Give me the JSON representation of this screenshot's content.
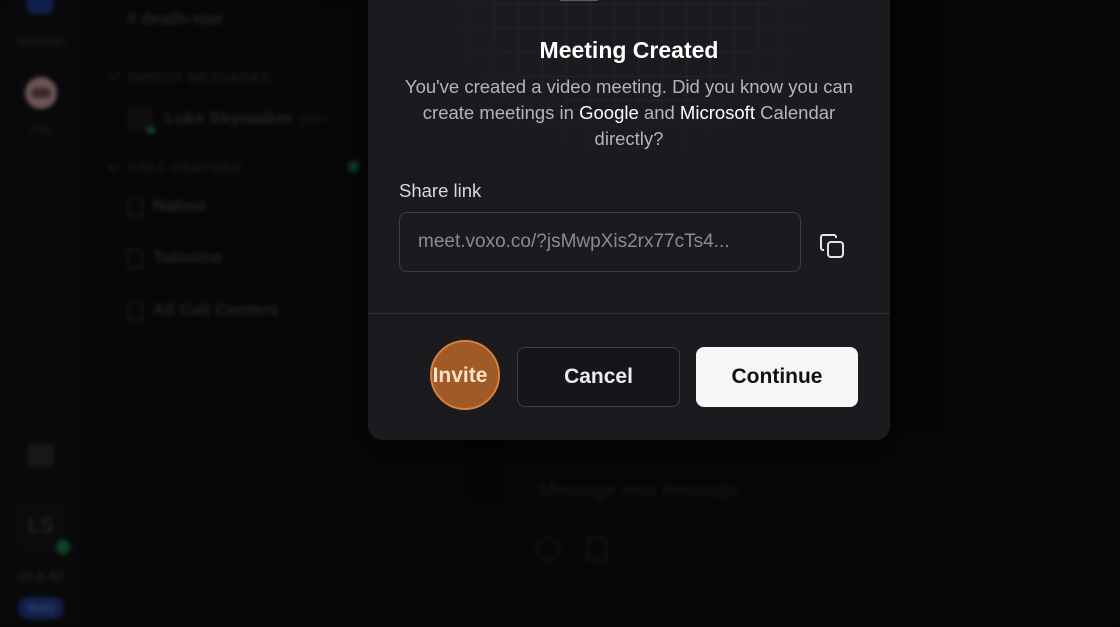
{
  "sidebar_rail": {
    "message_label": "Message",
    "fax_label": "Fax",
    "user_initials": "LS",
    "version": "v0.6.42",
    "beta_badge": "Beta"
  },
  "channel_list": {
    "top_channel": "# death-star",
    "direct_messages_header": "DIRECT MESSAGES",
    "dm_user": "Luke Skywalker",
    "dm_you_tag": "you",
    "call_centers_header": "CALL CENTERS",
    "call_centers": [
      "Naboo",
      "Tatooine",
      "All Call Centers"
    ]
  },
  "composer": {
    "placeholder": "Message new message..."
  },
  "modal": {
    "title": "Meeting Created",
    "description_part1": "You've created a video meeting. Did you know you can create meetings in ",
    "google": "Google",
    "and": " and ",
    "microsoft": "Microsoft",
    "description_part2": " Calendar directly?",
    "share_label": "Share link",
    "share_link": "meet.voxo.co/?jsMwpXis2rx77cTs4...",
    "invite_label": "Invite",
    "cancel_label": "Cancel",
    "continue_label": "Continue"
  }
}
